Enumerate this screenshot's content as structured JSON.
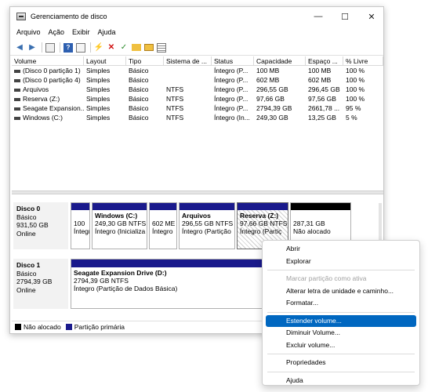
{
  "window": {
    "title": "Gerenciamento de disco",
    "minimize": "—",
    "maximize": "☐",
    "close": "✕"
  },
  "menu": [
    "Arquivo",
    "Ação",
    "Exibir",
    "Ajuda"
  ],
  "list": {
    "headers": [
      "Volume",
      "Layout",
      "Tipo",
      "Sistema de ...",
      "Status",
      "Capacidade",
      "Espaço ...",
      "% Livre"
    ],
    "rows": [
      [
        "(Disco 0 partição 1)",
        "Simples",
        "Básico",
        "",
        "Íntegro (P...",
        "100 MB",
        "100 MB",
        "100 %"
      ],
      [
        "(Disco 0 partição 4)",
        "Simples",
        "Básico",
        "",
        "Íntegro (P...",
        "602 MB",
        "602 MB",
        "100 %"
      ],
      [
        "Arquivos",
        "Simples",
        "Básico",
        "NTFS",
        "Íntegro (P...",
        "296,55 GB",
        "296,45 GB",
        "100 %"
      ],
      [
        "Reserva (Z:)",
        "Simples",
        "Básico",
        "NTFS",
        "Íntegro (P...",
        "97,66 GB",
        "97,56 GB",
        "100 %"
      ],
      [
        "Seagate Expansion...",
        "Simples",
        "Básico",
        "NTFS",
        "Íntegro (P...",
        "2794,39 GB",
        "2661,78 ...",
        "95 %"
      ],
      [
        "Windows (C:)",
        "Simples",
        "Básico",
        "NTFS",
        "Íntegro (In...",
        "249,30 GB",
        "13,25 GB",
        "5 %"
      ]
    ]
  },
  "disks": [
    {
      "name": "Disco 0",
      "type": "Básico",
      "size": "931,50 GB",
      "status": "Online",
      "partitions": [
        {
          "l1": "",
          "l2": "100",
          "l3": "Íntegro"
        },
        {
          "l1": "Windows  (C:)",
          "l2": "249,30 GB NTFS",
          "l3": "Íntegro (Inicializa"
        },
        {
          "l1": "",
          "l2": "602 ME",
          "l3": "Íntegro"
        },
        {
          "l1": "Arquivos",
          "l2": "296,55 GB NTFS",
          "l3": "Íntegro (Partição"
        },
        {
          "l1": "Reserva  (Z:)",
          "l2": "97,66 GB NTFS",
          "l3": "Íntegro (Partiç"
        },
        {
          "l1": "",
          "l2": "287,31 GB",
          "l3": "Não alocado"
        }
      ]
    },
    {
      "name": "Disco 1",
      "type": "Básico",
      "size": "2794,39 GB",
      "status": "Online",
      "partitions": [
        {
          "l1": "Seagate Expansion Drive  (D:)",
          "l2": "2794,39 GB NTFS",
          "l3": "Íntegro (Partição de Dados Básica)"
        }
      ]
    }
  ],
  "legend": {
    "unallocated": "Não alocado",
    "primary": "Partição primária"
  },
  "colors": {
    "primary": "#1a1a8c",
    "unallocated": "#000000",
    "highlight": "#0067c0"
  },
  "context_menu": {
    "items": [
      {
        "label": "Abrir"
      },
      {
        "label": "Explorar"
      },
      {
        "label": "Marcar partição como ativa"
      },
      {
        "label": "Alterar letra de unidade e caminho..."
      },
      {
        "label": "Formatar..."
      },
      {
        "label": "Estender volume..."
      },
      {
        "label": "Diminuir Volume..."
      },
      {
        "label": "Excluir volume..."
      },
      {
        "label": "Propriedades"
      },
      {
        "label": "Ajuda"
      }
    ]
  }
}
